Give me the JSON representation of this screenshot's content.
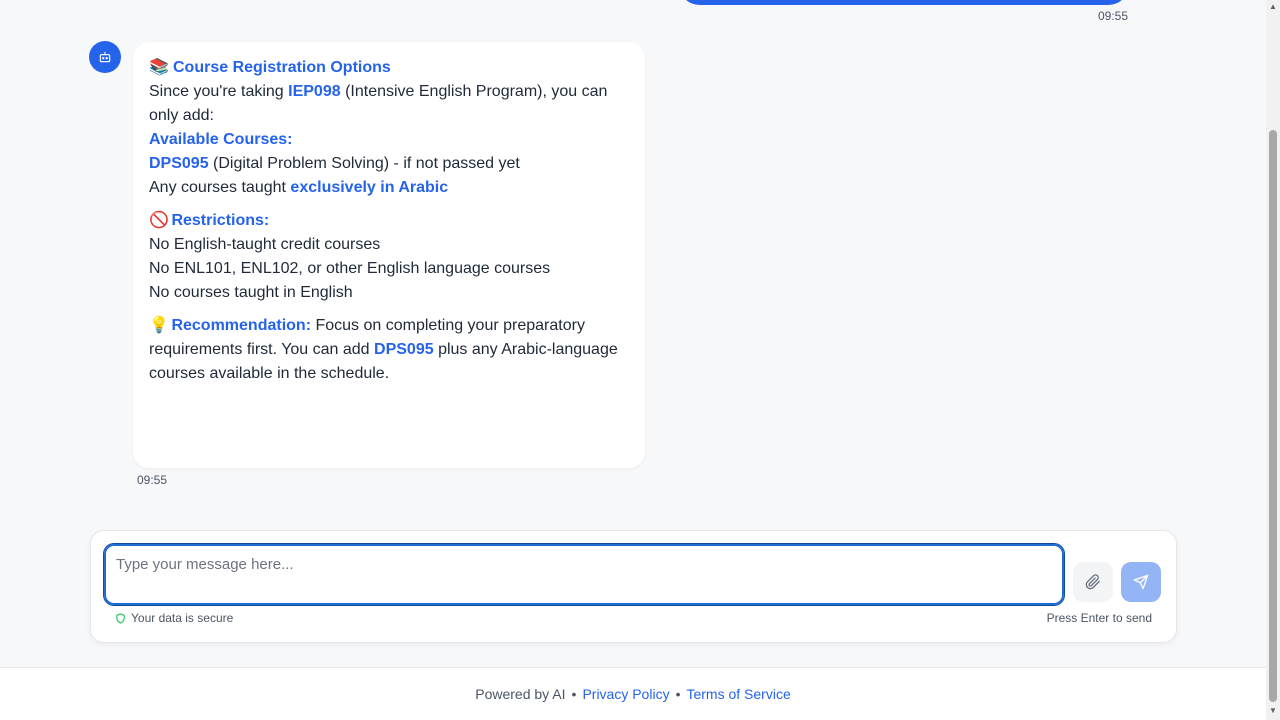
{
  "chat": {
    "user_message_time": "09:55",
    "bot_message": {
      "title_emoji": "📚",
      "title": "Course Registration Options",
      "intro_pre": "Since you're taking ",
      "intro_code": "IEP098",
      "intro_post": " (Intensive English Program), you can only add:",
      "available_heading": "Available Courses:",
      "available_1_code": "DPS095",
      "available_1_text": " (Digital Problem Solving) - if not passed yet",
      "available_2_pre": "Any courses taught ",
      "available_2_hl": "exclusively in Arabic",
      "restrictions_emoji": "🚫",
      "restrictions_heading": "Restrictions:",
      "restriction_1": "No English-taught credit courses",
      "restriction_2": "No ENL101, ENL102, or other English language courses",
      "restriction_3": "No courses taught in English",
      "recommendation_emoji": "💡",
      "recommendation_heading": "Recommendation:",
      "recommendation_pre": " Focus on completing your preparatory requirements first. You can add ",
      "recommendation_code": "DPS095",
      "recommendation_post": " plus any Arabic-language courses available in the schedule."
    },
    "bot_message_time": "09:55"
  },
  "composer": {
    "placeholder": "Type your message here...",
    "secure_text": "Your data is secure",
    "hint_text": "Press Enter to send"
  },
  "footer": {
    "powered": "Powered by AI",
    "separator": "•",
    "privacy": "Privacy Policy",
    "terms": "Terms of Service"
  },
  "colors": {
    "accent": "#2563eb",
    "send_disabled": "#93b4f5",
    "secure_icon": "#22c55e"
  }
}
